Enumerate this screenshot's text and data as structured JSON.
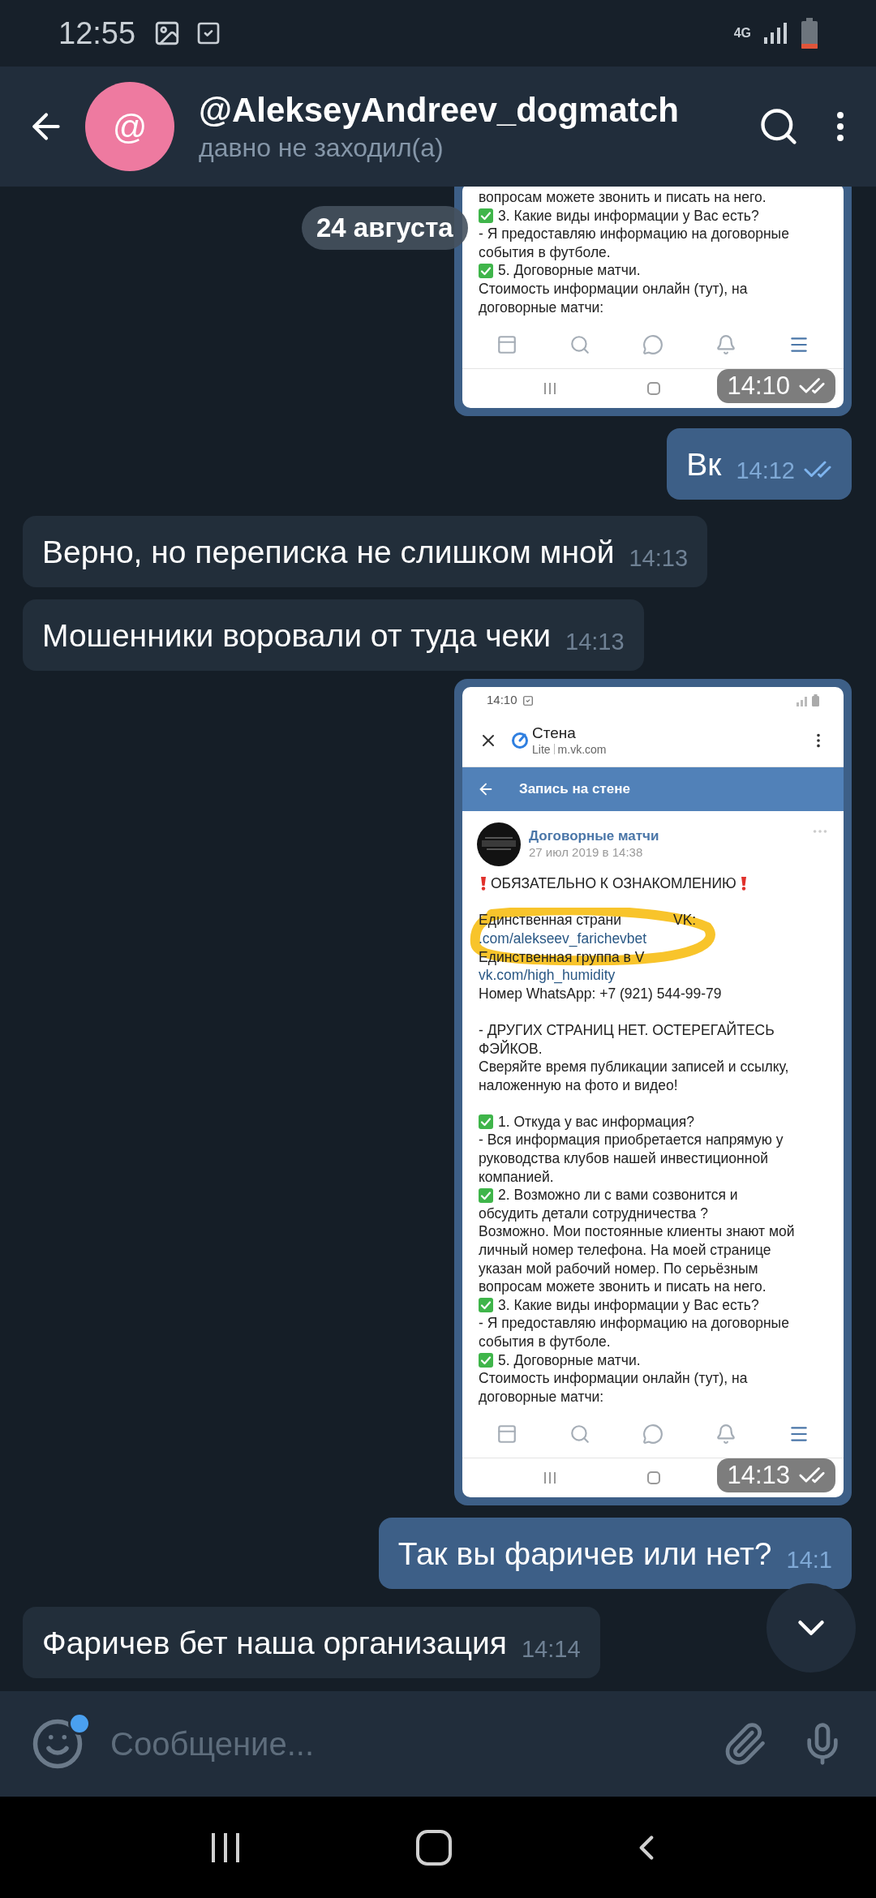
{
  "status_bar": {
    "time": "12:55",
    "network": "4G"
  },
  "header": {
    "avatar_letter": "@",
    "title": "@AlekseyAndreev_dogmatch",
    "subtitle": "давно не заходил(а)"
  },
  "date_badge": "24 августа",
  "messages": [
    {
      "kind": "screenshot",
      "outgoing": true,
      "time": "14:10",
      "read": true,
      "screen": {
        "blocks": [
          [
            {
              "kind": "text",
              "lines": [
                "вопросам можете звонить и писать на него."
              ]
            },
            {
              "kind": "check",
              "lines": [
                "3. Какие виды информации у Вас есть?"
              ]
            },
            {
              "kind": "text",
              "lines": [
                "- Я предоставляю информацию на договорные",
                "события в футболе."
              ]
            },
            {
              "kind": "check",
              "lines": [
                "5. Договорные матчи."
              ]
            },
            {
              "kind": "text",
              "lines": [
                "Стоимость информации онлайн (тут), на",
                "договорные матчи:"
              ]
            }
          ]
        ],
        "nav": [
          {
            "kind": "feed",
            "selected": false
          },
          {
            "kind": "search",
            "selected": false
          },
          {
            "kind": "messages",
            "selected": false
          },
          {
            "kind": "notifications",
            "selected": false
          },
          {
            "kind": "menu",
            "selected": true
          }
        ]
      }
    },
    {
      "kind": "text",
      "outgoing": true,
      "text": "Вк",
      "time": "14:12",
      "read": true
    },
    {
      "kind": "text",
      "outgoing": false,
      "text": "Верно, но переписка не слишком мной",
      "time": "14:13"
    },
    {
      "kind": "text",
      "outgoing": false,
      "text": "Мошенники воровали от туда чеки",
      "time": "14:13"
    },
    {
      "kind": "screenshot",
      "outgoing": true,
      "time": "14:13",
      "read": true,
      "screen": {
        "status_time": "14:10",
        "page_title": "Стена",
        "page_badge": "Lite",
        "page_url": "m.vk.com",
        "bar_title": "Запись на стене",
        "post": {
          "author": "Договорные матчи",
          "date": "27 июл 2019 в 14:38"
        },
        "blocks": [
          [
            {
              "kind": "alert",
              "lines": [
                "ОБЯЗАТЕЛЬНО К ОЗНАКОМЛЕНИЮ"
              ]
            }
          ],
          [
            {
              "kind": "highlighted",
              "lines": [
                {
                  "text": "Единственная страни",
                  "end": "VK:",
                  "link": false
                },
                {
                  "text": ".com/alekseev_farichevbet",
                  "link": true
                },
                {
                  "text": "Единственная группа в V",
                  "link": false
                }
              ]
            },
            {
              "kind": "link",
              "lines": [
                "vk.com/high_humidity"
              ]
            },
            {
              "kind": "text",
              "lines": [
                "Номер WhatsApp: +7 (921) 544-99-79"
              ]
            }
          ],
          [
            {
              "kind": "text",
              "lines": [
                "- ДРУГИХ СТРАНИЦ НЕТ. ОСТЕРЕГАЙТЕСЬ",
                "ФЭЙКОВ."
              ]
            },
            {
              "kind": "text",
              "lines": [
                "Сверяйте время публикации записей и ссылку,",
                "наложенную на фото и видео!"
              ]
            }
          ],
          [
            {
              "kind": "check",
              "lines": [
                "1. Откуда у вас информация?"
              ]
            },
            {
              "kind": "text",
              "lines": [
                "- Вся информация приобретается напрямую у",
                "руководства клубов нашей инвестиционной",
                "компанией."
              ]
            },
            {
              "kind": "check",
              "lines": [
                "2. Возможно ли с вами созвонится и"
              ]
            },
            {
              "kind": "text",
              "lines": [
                "обсудить детали сотрудничества ?"
              ]
            },
            {
              "kind": "text",
              "lines": [
                "Возможно. Мои постоянные клиенты знают мой",
                "личный номер телефона. На моей странице",
                "указан мой рабочий номер. По серьёзным",
                "вопросам можете звонить и писать на него."
              ]
            },
            {
              "kind": "check",
              "lines": [
                "3. Какие виды информации у Вас есть?"
              ]
            },
            {
              "kind": "text",
              "lines": [
                "- Я предоставляю информацию на договорные",
                "события в футболе."
              ]
            },
            {
              "kind": "check",
              "lines": [
                "5. Договорные матчи."
              ]
            },
            {
              "kind": "text",
              "lines": [
                "Стоимость информации онлайн (тут), на",
                "договорные матчи:"
              ]
            }
          ]
        ],
        "nav": [
          {
            "kind": "feed",
            "selected": false
          },
          {
            "kind": "search",
            "selected": false
          },
          {
            "kind": "messages",
            "selected": false
          },
          {
            "kind": "notifications",
            "selected": false
          },
          {
            "kind": "menu",
            "selected": true
          }
        ]
      }
    },
    {
      "kind": "text",
      "outgoing": true,
      "text": "Так вы фаричев или нет?",
      "time": "14:1"
    },
    {
      "kind": "text",
      "outgoing": false,
      "text": "Фаричев бет наша организация",
      "time": "14:14"
    }
  ],
  "input": {
    "placeholder": "Сообщение..."
  }
}
